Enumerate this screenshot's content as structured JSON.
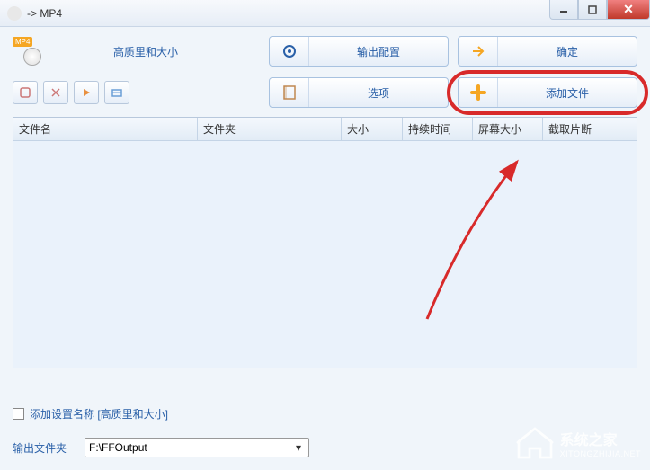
{
  "window": {
    "title": "-> MP4"
  },
  "format_icon": {
    "label": "MP4"
  },
  "quality_label": "高质里和大小",
  "buttons": {
    "output_config": "输出配置",
    "confirm": "确定",
    "options": "选项",
    "add_file": "添加文件"
  },
  "table_headers": [
    "文件名",
    "文件夹",
    "大小",
    "持续时间",
    "屏幕大小",
    "截取片断"
  ],
  "checkbox_label": "添加设置名称 [高质里和大小]",
  "output_folder": {
    "label": "输出文件夹",
    "value": "F:\\FFOutput"
  },
  "watermark": {
    "text1": "系统之家",
    "text2": "XITONGZHIJIA.NET"
  }
}
